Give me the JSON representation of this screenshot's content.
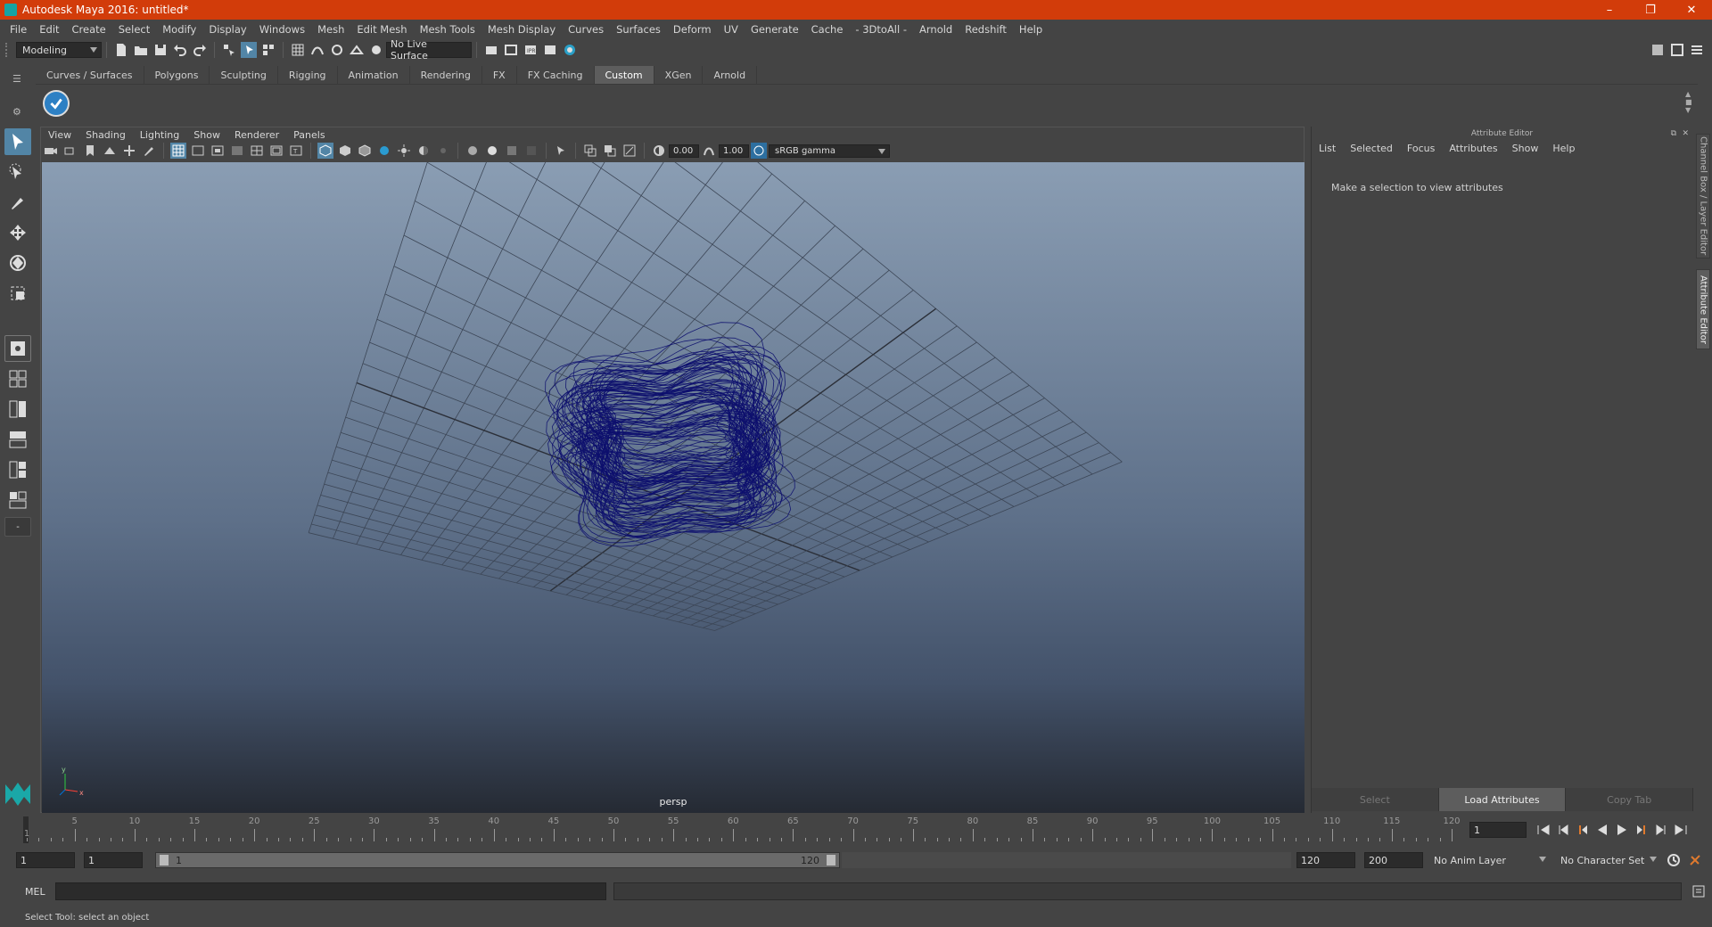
{
  "window": {
    "title": "Autodesk Maya 2016: untitled*",
    "minimize": "–",
    "maximize": "❐",
    "close": "✕"
  },
  "menubar": [
    "File",
    "Edit",
    "Create",
    "Select",
    "Modify",
    "Display",
    "Windows",
    "Mesh",
    "Edit Mesh",
    "Mesh Tools",
    "Mesh Display",
    "Curves",
    "Surfaces",
    "Deform",
    "UV",
    "Generate",
    "Cache",
    "- 3DtoAll -",
    "Arnold",
    "Redshift",
    "Help"
  ],
  "statusline": {
    "mode": "Modeling",
    "live_surface": "No Live Surface"
  },
  "shelf": {
    "tabs": [
      "Curves / Surfaces",
      "Polygons",
      "Sculpting",
      "Rigging",
      "Animation",
      "Rendering",
      "FX",
      "FX Caching",
      "Custom",
      "XGen",
      "Arnold"
    ],
    "active_tab": "Custom"
  },
  "viewport": {
    "menu": [
      "View",
      "Shading",
      "Lighting",
      "Show",
      "Renderer",
      "Panels"
    ],
    "exposure": "0.00",
    "gamma": "1.00",
    "color_space": "sRGB gamma",
    "camera_label": "persp",
    "wire_color": "#0d0f6e"
  },
  "attribute_editor": {
    "header": "Attribute Editor",
    "menu": [
      "List",
      "Selected",
      "Focus",
      "Attributes",
      "Show",
      "Help"
    ],
    "message": "Make a selection to view attributes",
    "buttons": {
      "select": "Select",
      "load": "Load Attributes",
      "copy": "Copy Tab"
    }
  },
  "side_tabs": {
    "channel_box": "Channel Box / Layer Editor",
    "attribute_editor": "Attribute Editor"
  },
  "timeline": {
    "ticks": [
      5,
      10,
      15,
      20,
      25,
      30,
      35,
      40,
      45,
      50,
      55,
      60,
      65,
      70,
      75,
      80,
      85,
      90,
      95,
      100,
      105,
      110,
      115,
      120
    ],
    "start_label": "1",
    "current_frame": "1",
    "min": 1,
    "max": 120
  },
  "range": {
    "start": "1",
    "playback_start": "1",
    "range_start_label": "1",
    "range_end_label": "120",
    "playback_end": "120",
    "end": "200",
    "anim_layer": "No Anim Layer",
    "character_set": "No Character Set"
  },
  "command_line": {
    "label": "MEL"
  },
  "help_line": "Select Tool: select an object"
}
